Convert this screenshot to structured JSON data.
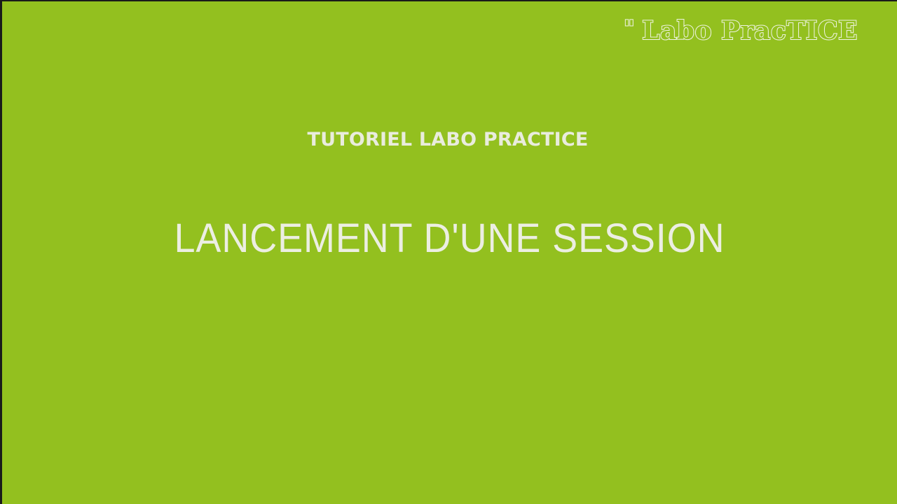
{
  "logo": {
    "quote": "\"",
    "text": "Labo PracTICE"
  },
  "slide": {
    "subtitle": "TUTORIEL LABO PRACTICE",
    "title": "LANCEMENT D'UNE SESSION"
  },
  "colors": {
    "background": "#93c01f",
    "text": "#eceee2"
  }
}
